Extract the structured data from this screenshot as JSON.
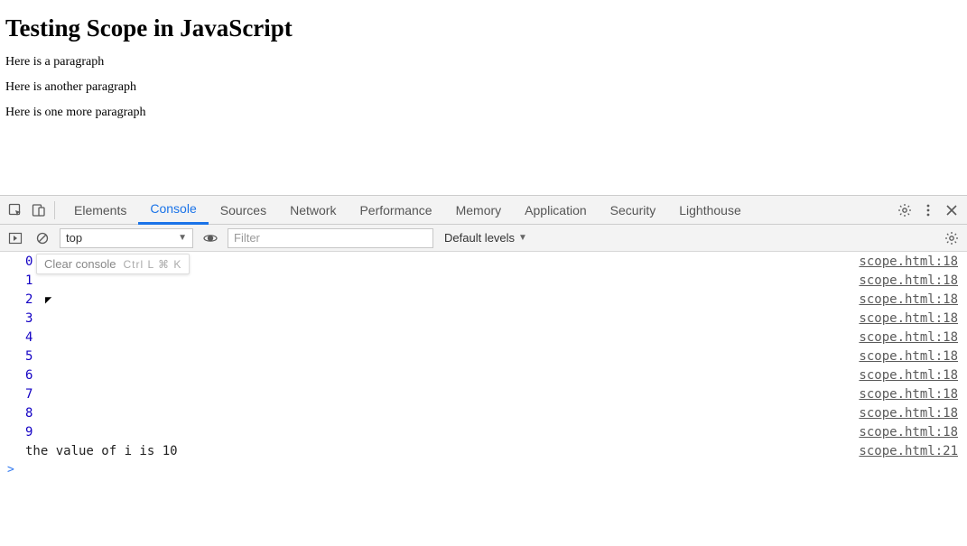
{
  "page": {
    "title": "Testing Scope in JavaScript",
    "paragraphs": [
      "Here is a paragraph",
      "Here is another paragraph",
      "Here is one more paragraph"
    ]
  },
  "devtools": {
    "tabs": [
      {
        "label": "Elements",
        "active": false
      },
      {
        "label": "Console",
        "active": true
      },
      {
        "label": "Sources",
        "active": false
      },
      {
        "label": "Network",
        "active": false
      },
      {
        "label": "Performance",
        "active": false
      },
      {
        "label": "Memory",
        "active": false
      },
      {
        "label": "Application",
        "active": false
      },
      {
        "label": "Security",
        "active": false
      },
      {
        "label": "Lighthouse",
        "active": false
      }
    ],
    "console_toolbar": {
      "context": "top",
      "filter_placeholder": "Filter",
      "levels_label": "Default levels"
    },
    "tooltip": {
      "label": "Clear console",
      "shortcut": "Ctrl L   ⌘ K"
    },
    "logs": [
      {
        "value": "0",
        "type": "number",
        "source": "scope.html:18"
      },
      {
        "value": "1",
        "type": "number",
        "source": "scope.html:18"
      },
      {
        "value": "2",
        "type": "number",
        "source": "scope.html:18"
      },
      {
        "value": "3",
        "type": "number",
        "source": "scope.html:18"
      },
      {
        "value": "4",
        "type": "number",
        "source": "scope.html:18"
      },
      {
        "value": "5",
        "type": "number",
        "source": "scope.html:18"
      },
      {
        "value": "6",
        "type": "number",
        "source": "scope.html:18"
      },
      {
        "value": "7",
        "type": "number",
        "source": "scope.html:18"
      },
      {
        "value": "8",
        "type": "number",
        "source": "scope.html:18"
      },
      {
        "value": "9",
        "type": "number",
        "source": "scope.html:18"
      },
      {
        "value": "the value of i is 10",
        "type": "string",
        "source": "scope.html:21"
      }
    ],
    "prompt": ">"
  }
}
